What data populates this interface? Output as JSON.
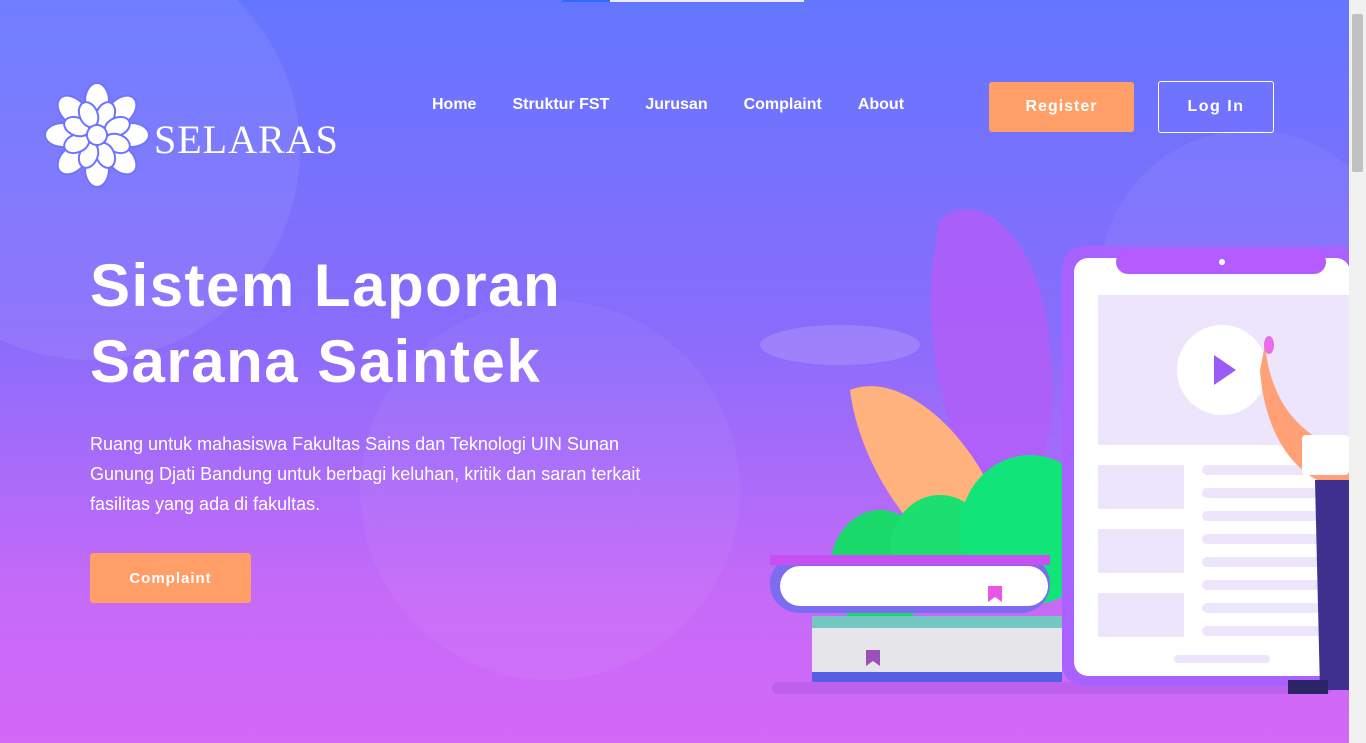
{
  "brand": {
    "name": "SELARAS"
  },
  "nav": {
    "items": [
      {
        "label": "Home"
      },
      {
        "label": "Struktur FST"
      },
      {
        "label": "Jurusan"
      },
      {
        "label": "Complaint"
      },
      {
        "label": "About"
      }
    ],
    "register_label": "Register",
    "login_label": "Log In"
  },
  "hero": {
    "title_line1": "Sistem Laporan",
    "title_line2": "Sarana Saintek",
    "description": "Ruang untuk mahasiswa Fakultas Sains dan Teknologi UIN Sunan Gunung Djati Bandung untuk berbagi keluhan, kritik dan saran terkait fasilitas yang ada di fakultas.",
    "cta_label": "Complaint"
  },
  "colors": {
    "gradient_top": "#6476ff",
    "gradient_bottom": "#d468f7",
    "accent_orange": "#ff9e67"
  },
  "icons": {
    "logo": "lotus-logo-icon",
    "play": "play-icon",
    "bookmark": "bookmark-icon"
  }
}
